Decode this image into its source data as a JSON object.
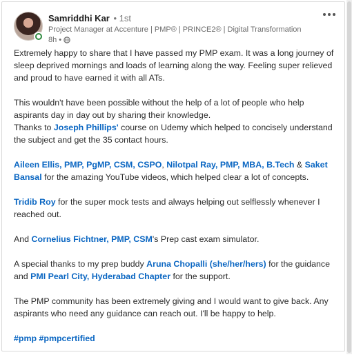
{
  "post": {
    "author": {
      "name": "Samriddhi Kar",
      "degree": "• 1st",
      "headline": "Project Manager at Accenture | PMP® | PRINCE2® | Digital Transformation",
      "time": "8h •",
      "visibility_icon": "globe-icon"
    },
    "more_icon": "ellipsis-icon",
    "body": {
      "p1": "Extremely happy to share that I have passed my PMP exam. It was a long journey of sleep deprived mornings and loads of learning along the way. Feeling super relieved and proud to have earned it with all ATs.",
      "p2_line1": "This wouldn't have been possible without the help of a lot of people who help aspirants day in day out by sharing their knowledge.",
      "p2_thanks_prefix": "Thanks to ",
      "p2_mention": "Joseph Phillips'",
      "p2_thanks_suffix": " course on Udemy which helped to concisely understand the subject and get the 35 contact hours.",
      "p3_mention1": "Aileen Ellis, PMP, PgMP, CSM, CSPO",
      "p3_sep1": ", ",
      "p3_mention2": "Nilotpal Ray, PMP, MBA, B.Tech",
      "p3_sep2": " & ",
      "p3_mention3": "Saket Bansal",
      "p3_suffix": " for the amazing YouTube videos, which helped clear a lot of concepts.",
      "p4_mention": "Tridib Roy",
      "p4_suffix": " for the super mock tests and always helping out selflessly whenever I reached out.",
      "p5_prefix": "And ",
      "p5_mention": "Cornelius Fichtner, PMP, CSM",
      "p5_suffix": "'s Prep cast exam simulator.",
      "p6_prefix": "A special thanks to my prep buddy ",
      "p6_mention1": "Aruna Chopalli (she/her/hers)",
      "p6_mid": " for the guidance and ",
      "p6_mention2": "PMI Pearl City, Hyderabad Chapter",
      "p6_suffix": " for the support.",
      "p7": "The PMP community has been extremely giving and I would want to give back. Any aspirants who need any guidance can reach out. I'll be happy to help.",
      "hashtag1": "#pmp",
      "hashtag2": "#pmpcertified"
    }
  },
  "colors": {
    "link": "#0a66c2",
    "presence": "#2f8a3f"
  }
}
